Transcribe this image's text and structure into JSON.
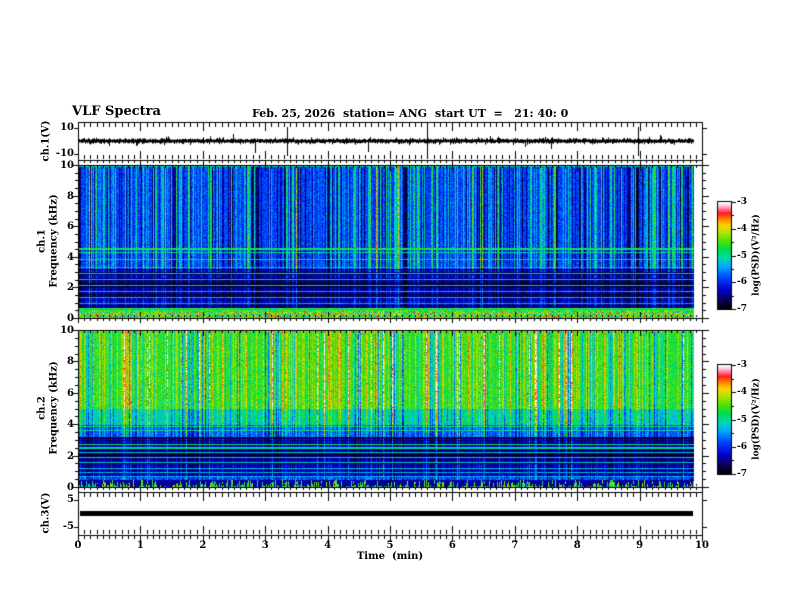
{
  "figure": {
    "title": "VLF Spectra",
    "date": "Feb. 25, 2026",
    "station": "station= ANG",
    "start_ut": "start UT  =   21: 40: 0"
  },
  "time_axis": {
    "label": "Time  (min)",
    "min": 0,
    "max": 10,
    "minor_step": 0.1,
    "tick_labels": [
      "0",
      "1",
      "2",
      "3",
      "4",
      "5",
      "6",
      "7",
      "8",
      "9",
      "10"
    ]
  },
  "panels": {
    "ch1v": {
      "name": "ch.1(V)",
      "ymax": "10",
      "ymin": "-10"
    },
    "ch1spec": {
      "name_line1": "ch.1",
      "name_line2": "Frequency (kHz)",
      "tick_labels": [
        "10",
        "8",
        "6",
        "4",
        "2",
        "0"
      ]
    },
    "ch2spec": {
      "name_line1": "ch.2",
      "name_line2": "Frequency (kHz)",
      "tick_labels": [
        "10",
        "8",
        "6",
        "4",
        "2",
        "0"
      ]
    },
    "ch3v": {
      "name": "ch.3(V)",
      "ymax": "5",
      "ymin": "-5"
    }
  },
  "colorbars": [
    {
      "label": "log(PSD)(V²/Hz)",
      "tick_labels": [
        "-3",
        "-4",
        "-5",
        "-6",
        "-7"
      ],
      "zmax": -3,
      "zmin": -7
    },
    {
      "label": "log(PSD)(V²/Hz)",
      "tick_labels": [
        "-3",
        "-4",
        "-5",
        "-6",
        "-7"
      ],
      "zmax": -3,
      "zmin": -7
    }
  ],
  "chart_data": [
    {
      "id": "ch1_waveform",
      "type": "line",
      "ylabel": "ch.1(V)",
      "xlim": [
        0,
        10
      ],
      "yticks": [
        10,
        -10
      ],
      "data_tmax": 9.85,
      "signal": "broadband noise centered on 0 V, amplitude ~±1 V",
      "impulses": [
        {
          "t": 2.48,
          "up": 7,
          "down": 2
        },
        {
          "t": 2.83,
          "up": 2,
          "down": 12
        },
        {
          "t": 3.35,
          "up": 14,
          "down": 15
        },
        {
          "t": 4.65,
          "up": 2,
          "down": 11
        },
        {
          "t": 5.6,
          "up": 14,
          "down": 15
        },
        {
          "t": 6.6,
          "up": 5,
          "down": 2
        },
        {
          "t": 7.58,
          "up": 3,
          "down": 8
        },
        {
          "t": 8.97,
          "up": 14,
          "down": 15
        },
        {
          "t": 9.33,
          "up": 6,
          "down": 2
        }
      ]
    },
    {
      "id": "ch1_spectrogram",
      "type": "heatmap",
      "xlabel": "Time (min)",
      "ylabel": "ch.1 Frequency (kHz)",
      "xlim": [
        0,
        10
      ],
      "flim": [
        0,
        10
      ],
      "data_tmax": 9.85,
      "zlabel": "log(PSD)(V²/Hz)",
      "zlim": [
        -7,
        -3
      ],
      "seed": 11,
      "streaks": {
        "p_strong": 0.5,
        "strength": 0.42,
        "p_red": 0.012,
        "neg": 0.18
      },
      "regions": [
        {
          "f": [
            3.2,
            10.01
          ],
          "base": 0.27,
          "noise": 0.07,
          "streak": 1.0
        },
        {
          "f": [
            0.62,
            3.2
          ],
          "base": 0.17,
          "noise": 0.04,
          "streak": 0.5,
          "stripes": true
        },
        {
          "f": [
            0.45,
            0.62
          ],
          "base": 0.3,
          "noise": 0.1,
          "streak": 0.5
        },
        {
          "f": [
            0.0,
            0.45
          ],
          "base": 0.5,
          "mode": "speckle"
        }
      ],
      "hlines": [
        {
          "f": 9.95,
          "w": 1,
          "v": 0.48
        },
        {
          "f": 4.55,
          "w": 2,
          "v": 0.58
        },
        {
          "f": 4.28,
          "w": 1,
          "v": 0.5
        },
        {
          "f": 3.85,
          "w": 1,
          "v": 0.48
        },
        {
          "f": 3.3,
          "w": 1,
          "v": 0.4
        },
        {
          "f": 2.95,
          "w": 1,
          "v": 0.46
        },
        {
          "f": 2.55,
          "w": 1,
          "v": 0.44
        },
        {
          "f": 2.12,
          "w": 1,
          "v": 0.44
        },
        {
          "f": 1.72,
          "w": 1,
          "v": 0.42
        },
        {
          "f": 1.33,
          "w": 1,
          "v": 0.42
        },
        {
          "f": 0.95,
          "w": 1,
          "v": 0.4
        },
        {
          "f": 0.56,
          "w": 2,
          "v": 0.6
        }
      ]
    },
    {
      "id": "ch2_spectrogram",
      "type": "heatmap",
      "xlabel": "Time (min)",
      "ylabel": "ch.2 Frequency (kHz)",
      "xlim": [
        0,
        10
      ],
      "flim": [
        0,
        10
      ],
      "data_tmax": 9.85,
      "zlabel": "log(PSD)(V²/Hz)",
      "zlim": [
        -7,
        -3
      ],
      "seed": 29,
      "streaks": {
        "p_strong": 0.55,
        "strength": 0.3,
        "p_red": 0.06,
        "neg": 0.16
      },
      "regions": [
        {
          "f": [
            5.0,
            10.01
          ],
          "base": 0.58,
          "noise": 0.08,
          "streak": 1.0
        },
        {
          "f": [
            4.0,
            5.0
          ],
          "base": 0.46,
          "noise": 0.08,
          "streak": 0.9
        },
        {
          "f": [
            3.2,
            4.0
          ],
          "base": 0.3,
          "noise": 0.07,
          "streak": 0.8
        },
        {
          "f": [
            0.62,
            3.2
          ],
          "base": 0.16,
          "noise": 0.04,
          "streak": 0.45,
          "stripes": true
        },
        {
          "f": [
            0.45,
            0.62
          ],
          "base": 0.28,
          "noise": 0.1,
          "streak": 0.5
        },
        {
          "f": [
            0.0,
            0.45
          ],
          "base": 0.1,
          "mode": "spikes"
        }
      ],
      "hlines": [
        {
          "f": 9.95,
          "w": 1,
          "v": 0.68
        },
        {
          "f": 3.85,
          "w": 1,
          "v": 0.55
        },
        {
          "f": 3.6,
          "w": 1,
          "v": 0.52
        },
        {
          "f": 2.72,
          "w": 1,
          "v": 0.55
        },
        {
          "f": 2.5,
          "w": 1,
          "v": 0.52
        },
        {
          "f": 2.2,
          "w": 1,
          "v": 0.46
        },
        {
          "f": 1.9,
          "w": 1,
          "v": 0.46
        },
        {
          "f": 1.55,
          "w": 1,
          "v": 0.46
        },
        {
          "f": 1.18,
          "w": 1,
          "v": 0.44
        },
        {
          "f": 0.95,
          "w": 1,
          "v": 0.43
        },
        {
          "f": 0.7,
          "w": 1,
          "v": 0.43
        }
      ]
    },
    {
      "id": "ch3_waveform",
      "type": "line",
      "ylabel": "ch.3(V)",
      "xlim": [
        0,
        10
      ],
      "yticks": [
        5,
        -5
      ],
      "data_tmax": 9.85,
      "signal": "constant 0 V (flat thick line)"
    }
  ],
  "colormap": [
    [
      0.0,
      "#000000"
    ],
    [
      0.08,
      "#08004a"
    ],
    [
      0.18,
      "#0000c8"
    ],
    [
      0.3,
      "#0048ff"
    ],
    [
      0.4,
      "#00a8ff"
    ],
    [
      0.48,
      "#00d8b0"
    ],
    [
      0.56,
      "#00dc50"
    ],
    [
      0.64,
      "#52e200"
    ],
    [
      0.72,
      "#b4e400"
    ],
    [
      0.79,
      "#ffd200"
    ],
    [
      0.85,
      "#ff7800"
    ],
    [
      0.9,
      "#ff1e1e"
    ],
    [
      0.94,
      "#ff78a0"
    ],
    [
      0.97,
      "#ffc8dc"
    ],
    [
      1.0,
      "#ffffff"
    ]
  ]
}
